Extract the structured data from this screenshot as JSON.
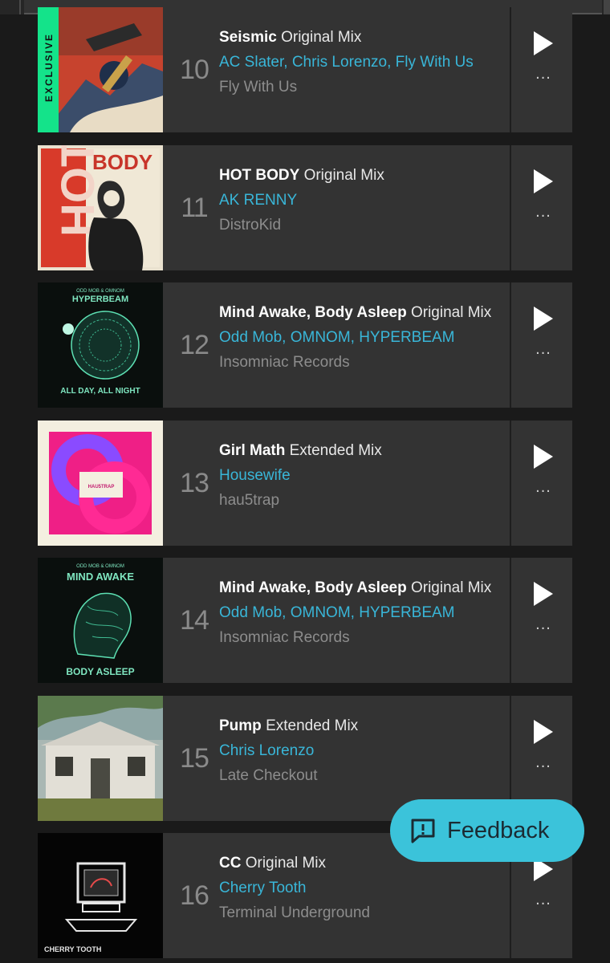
{
  "tracks": [
    {
      "rank": "10",
      "title": "Seismic",
      "mix": "Original Mix",
      "artists": "AC Slater, Chris Lorenzo, Fly With Us",
      "label": "Fly With Us",
      "badge": "EXCLUSIVE"
    },
    {
      "rank": "11",
      "title": "HOT BODY",
      "mix": "Original Mix",
      "artists": "AK RENNY",
      "label": "DistroKid",
      "art_text": [
        "HOT",
        "BODY"
      ]
    },
    {
      "rank": "12",
      "title": "Mind Awake, Body Asleep",
      "mix": "Original Mix",
      "artists": "Odd Mob, OMNOM, HYPERBEAM",
      "label": "Insomniac Records",
      "art_text": [
        "ODD MOB & OMNOM",
        "HYPERBEAM",
        "ALL DAY, ALL NIGHT"
      ]
    },
    {
      "rank": "13",
      "title": "Girl Math",
      "mix": "Extended Mix",
      "artists": "Housewife",
      "label": "hau5trap",
      "art_text": [
        "HAU5TRAP"
      ]
    },
    {
      "rank": "14",
      "title": "Mind Awake, Body Asleep",
      "mix": "Original Mix",
      "artists": "Odd Mob, OMNOM, HYPERBEAM",
      "label": "Insomniac Records",
      "art_text": [
        "ODD MOB & OMNOM",
        "MIND AWAKE",
        "BODY ASLEEP"
      ]
    },
    {
      "rank": "15",
      "title": "Pump",
      "mix": "Extended Mix",
      "artists": "Chris Lorenzo",
      "label": "Late Checkout"
    },
    {
      "rank": "16",
      "title": "CC",
      "mix": "Original Mix",
      "artists": "Cherry Tooth",
      "label": "Terminal Underground",
      "art_text": [
        "CHERRY TOOTH"
      ]
    }
  ],
  "more_glyph": "...",
  "feedback": {
    "label": "Feedback",
    "icon": "message-alert-icon"
  },
  "colors": {
    "artist": "#39b6d8",
    "exclusive": "#14e38a",
    "feedback": "#3bc3da"
  }
}
